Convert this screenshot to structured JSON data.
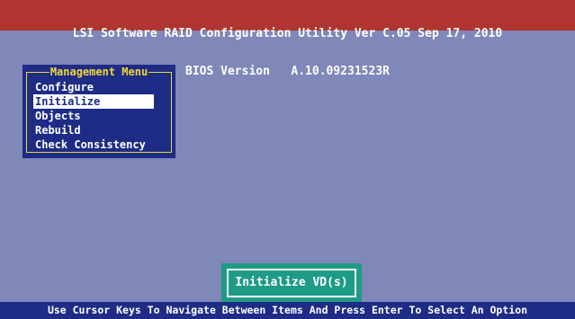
{
  "header": {
    "title": "LSI Software RAID Configuration Utility Ver C.05 Sep 17, 2010",
    "subtitle": "BIOS Version   A.10.09231523R"
  },
  "menu": {
    "title": "Management Menu",
    "items": [
      {
        "label": "Configure"
      },
      {
        "label": "Initialize"
      },
      {
        "label": "Objects"
      },
      {
        "label": "Rebuild"
      },
      {
        "label": "Check Consistency"
      }
    ],
    "selected": "Initialize"
  },
  "status": {
    "label": "Initialize VD(s)"
  },
  "help": {
    "text": "Use Cursor Keys To Navigate Between Items And Press Enter To Select An Option"
  },
  "colors": {
    "background": "#7f88b8",
    "title_bar": "#b03531",
    "menu_background": "#1e2c86",
    "menu_border": "#f0d83a",
    "status_box": "#1e9b86",
    "help_bar": "#1e2c86"
  }
}
